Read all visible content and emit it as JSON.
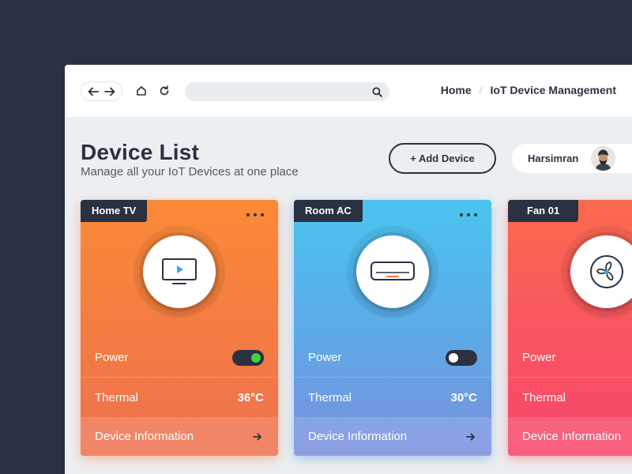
{
  "header": {
    "search_placeholder": "",
    "breadcrumb": [
      "Home",
      "IoT Device Management"
    ]
  },
  "page": {
    "title": "Device List",
    "subtitle": "Manage all your IoT Devices at one place",
    "add_button": "+ Add Device"
  },
  "user": {
    "name": "Harsimran"
  },
  "devices": [
    {
      "name": "Home TV",
      "icon": "tv-icon",
      "power_label": "Power",
      "power_on": true,
      "thermal_label": "Thermal",
      "thermal_value": "36°C",
      "info_label": "Device Information"
    },
    {
      "name": "Room AC",
      "icon": "air-conditioner-icon",
      "power_label": "Power",
      "power_on": false,
      "thermal_label": "Thermal",
      "thermal_value": "30°C",
      "info_label": "Device Information"
    },
    {
      "name": "Fan 01",
      "icon": "fan-icon",
      "power_label": "Power",
      "thermal_label": "Thermal",
      "info_label": "Device Information"
    }
  ],
  "colors": {
    "dark": "#2a3140",
    "orange": "#fb8a37",
    "blue": "#4ac4ef",
    "red": "#f8466a",
    "toggle_on": "#41d04a"
  }
}
